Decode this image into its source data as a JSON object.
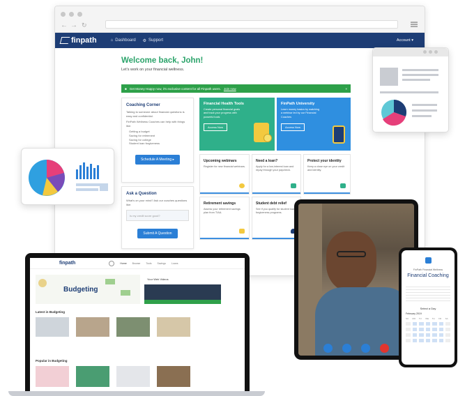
{
  "browser": {
    "brand": "finpath",
    "nav": [
      {
        "label": "Dashboard"
      },
      {
        "label": "Support"
      }
    ],
    "account": "Account",
    "welcome": "Welcome back, John!",
    "subtitle": "Let's work on your financial wellness.",
    "banner": {
      "text": "Get Money Happy now, it's exclusive content for all Finpath users.",
      "cta": "Join now"
    },
    "coaching": {
      "title": "Coaching Corner",
      "intro": "Talking to someone about financial questions is easy and confidential.",
      "list_intro": "FinPath Wellness Coaches can help with things like:",
      "items": [
        "Getting a budget",
        "Saving for retirement",
        "Saving for college",
        "Student loan forgiveness"
      ],
      "button": "Schedule A Meeting"
    },
    "ask": {
      "title": "Ask a Question",
      "intro": "What's on your mind? Ask our coaches questions like:",
      "placeholder": "Is my credit score good?",
      "button": "Submit A Question"
    },
    "featured": [
      {
        "title": "Financial Health Tools",
        "text": "Create personal financial goals and track your progress with powerful tools",
        "button": "Access Now",
        "color": "#2fb08a"
      },
      {
        "title": "FinPath University",
        "text": "Learn money basics by watching a webinar led by our Financial Coaches",
        "button": "Access Now",
        "color": "#2f8fe0"
      }
    ],
    "tiles": [
      {
        "title": "Upcoming webinars",
        "text": "Register for new financial webinars."
      },
      {
        "title": "Need a loan?",
        "text": "Apply for a low-interest loan and repay through your paycheck."
      },
      {
        "title": "Protect your identity",
        "text": "Keep a close eye on your credit and identity."
      },
      {
        "title": "Retirement savings",
        "text": "Assess your retirement savings plan from TIAA."
      },
      {
        "title": "Student debt relief",
        "text": "See if you qualify for student loan forgiveness programs."
      }
    ]
  },
  "laptop": {
    "brand": "finpath",
    "nav": [
      "Home",
      "Browse",
      "Tools",
      "Savings",
      "Loans"
    ],
    "hero": "Budgeting",
    "side_title": "Your Web Videos",
    "section1": "Latest in Budgeting",
    "section2": "Popular in Budgeting"
  },
  "phone": {
    "brand": "FinPath Financial Wellness",
    "title": "Financial Coaching",
    "select_label": "Select a Day",
    "month": "February 2019",
    "weekdays": [
      "SU",
      "MO",
      "TU",
      "WE",
      "TH",
      "FR",
      "SA"
    ]
  },
  "tablet": {
    "controls": [
      "camera-icon",
      "mic-icon",
      "chat-icon",
      "end-call-icon"
    ]
  },
  "colors": {
    "navy": "#1d3d75",
    "green": "#2da049",
    "blue": "#2b7fd6",
    "teal": "#2fb08a",
    "end_call": "#e0352f"
  }
}
